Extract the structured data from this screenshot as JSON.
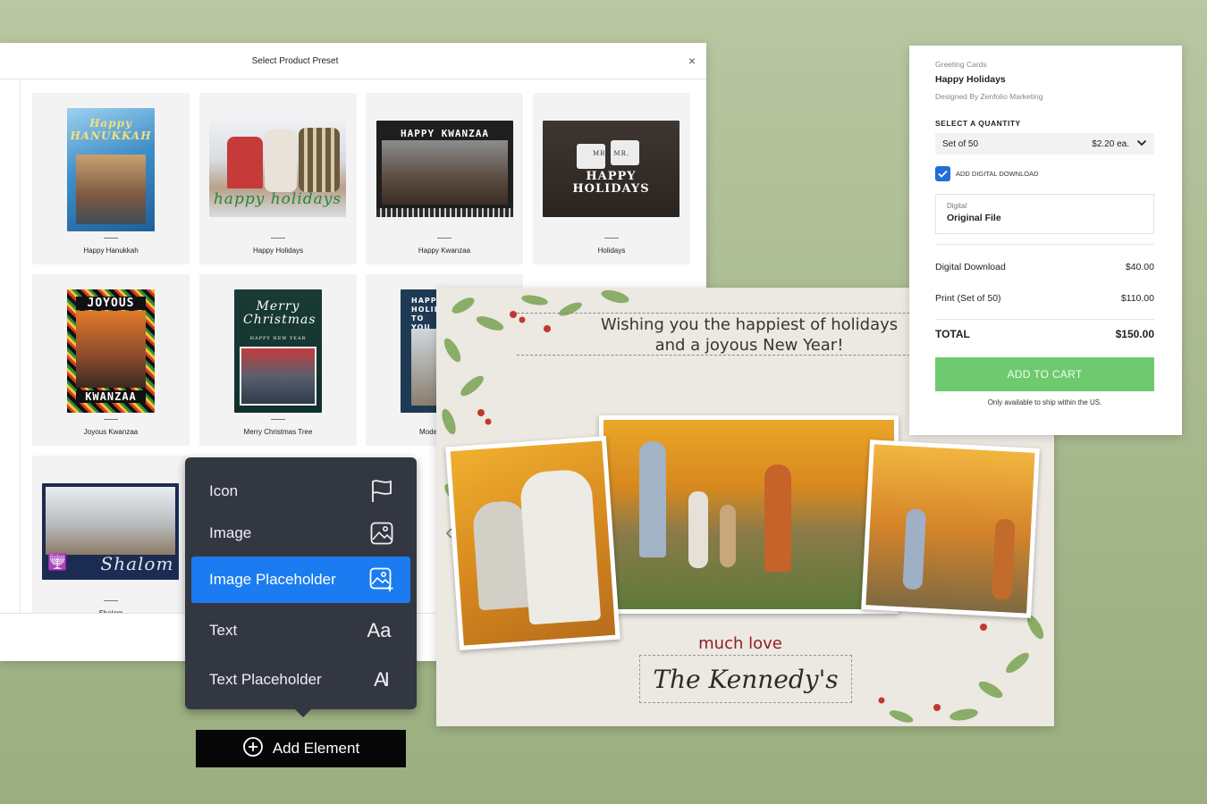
{
  "preset_dialog": {
    "title": "Select Product Preset",
    "close_label": "×",
    "presets": [
      {
        "label": "Happy Hanukkah",
        "thumb_text": "Happy HANUKKAH"
      },
      {
        "label": "Happy Holidays",
        "thumb_text": "happy holidays"
      },
      {
        "label": "Happy Kwanzaa",
        "thumb_text": "HAPPY KWANZAA"
      },
      {
        "label": "Holidays",
        "thumb_text": "HAPPY HOLIDAYS",
        "thumb_text_2": "MRS  MR."
      },
      {
        "label": "Joyous Kwanzaa",
        "thumb_text": "JOYOUS",
        "thumb_text_2": "KWANZAA"
      },
      {
        "label": "Merry Christmas Tree",
        "thumb_text": "Merry Christmas",
        "thumb_text_2": "HAPPY NEW YEAR"
      },
      {
        "label": "Mode",
        "thumb_text": "HAPPY HOLIDA TO YOU"
      },
      {
        "label": "Shalom",
        "thumb_text": "Shalom"
      }
    ]
  },
  "element_menu": {
    "items": [
      {
        "label": "Icon",
        "icon": "flag-icon"
      },
      {
        "label": "Image",
        "icon": "image-icon"
      },
      {
        "label": "Image Placeholder",
        "icon": "image-placeholder-icon"
      },
      {
        "label": "Text",
        "icon": "text-icon",
        "glyph": "Aa"
      },
      {
        "label": "Text Placeholder",
        "icon": "text-placeholder-icon",
        "glyph": "A"
      }
    ],
    "active_index": 2,
    "add_button": "Add Element"
  },
  "card_preview": {
    "greeting_line1": "Wishing you the happiest of holidays",
    "greeting_line2": "and a joyous New Year!",
    "much_love": "much love",
    "signature": "The Kennedy's",
    "prev_arrow": "‹"
  },
  "order_panel": {
    "category": "Greeting Cards",
    "title": "Happy Holidays",
    "designer": "Designed By Zenfolio Marketing",
    "select_quantity_label": "SELECT A QUANTITY",
    "quantity_value": "Set of 50",
    "quantity_price": "$2.20 ea.",
    "digital_checkbox_label": "ADD DIGITAL DOWNLOAD",
    "digital_checked": true,
    "digital_box_small": "Digital",
    "digital_box_value": "Original File",
    "lines": [
      {
        "label": "Digital Download",
        "amount": "$40.00"
      },
      {
        "label": "Print (Set of 50)",
        "amount": "$110.00"
      }
    ],
    "total_label": "TOTAL",
    "total_amount": "$150.00",
    "cart_button": "ADD TO CART",
    "ship_note": "Only available to ship within the US.",
    "accent_green": "#6fca6f",
    "accent_blue": "#1a7cf0"
  }
}
